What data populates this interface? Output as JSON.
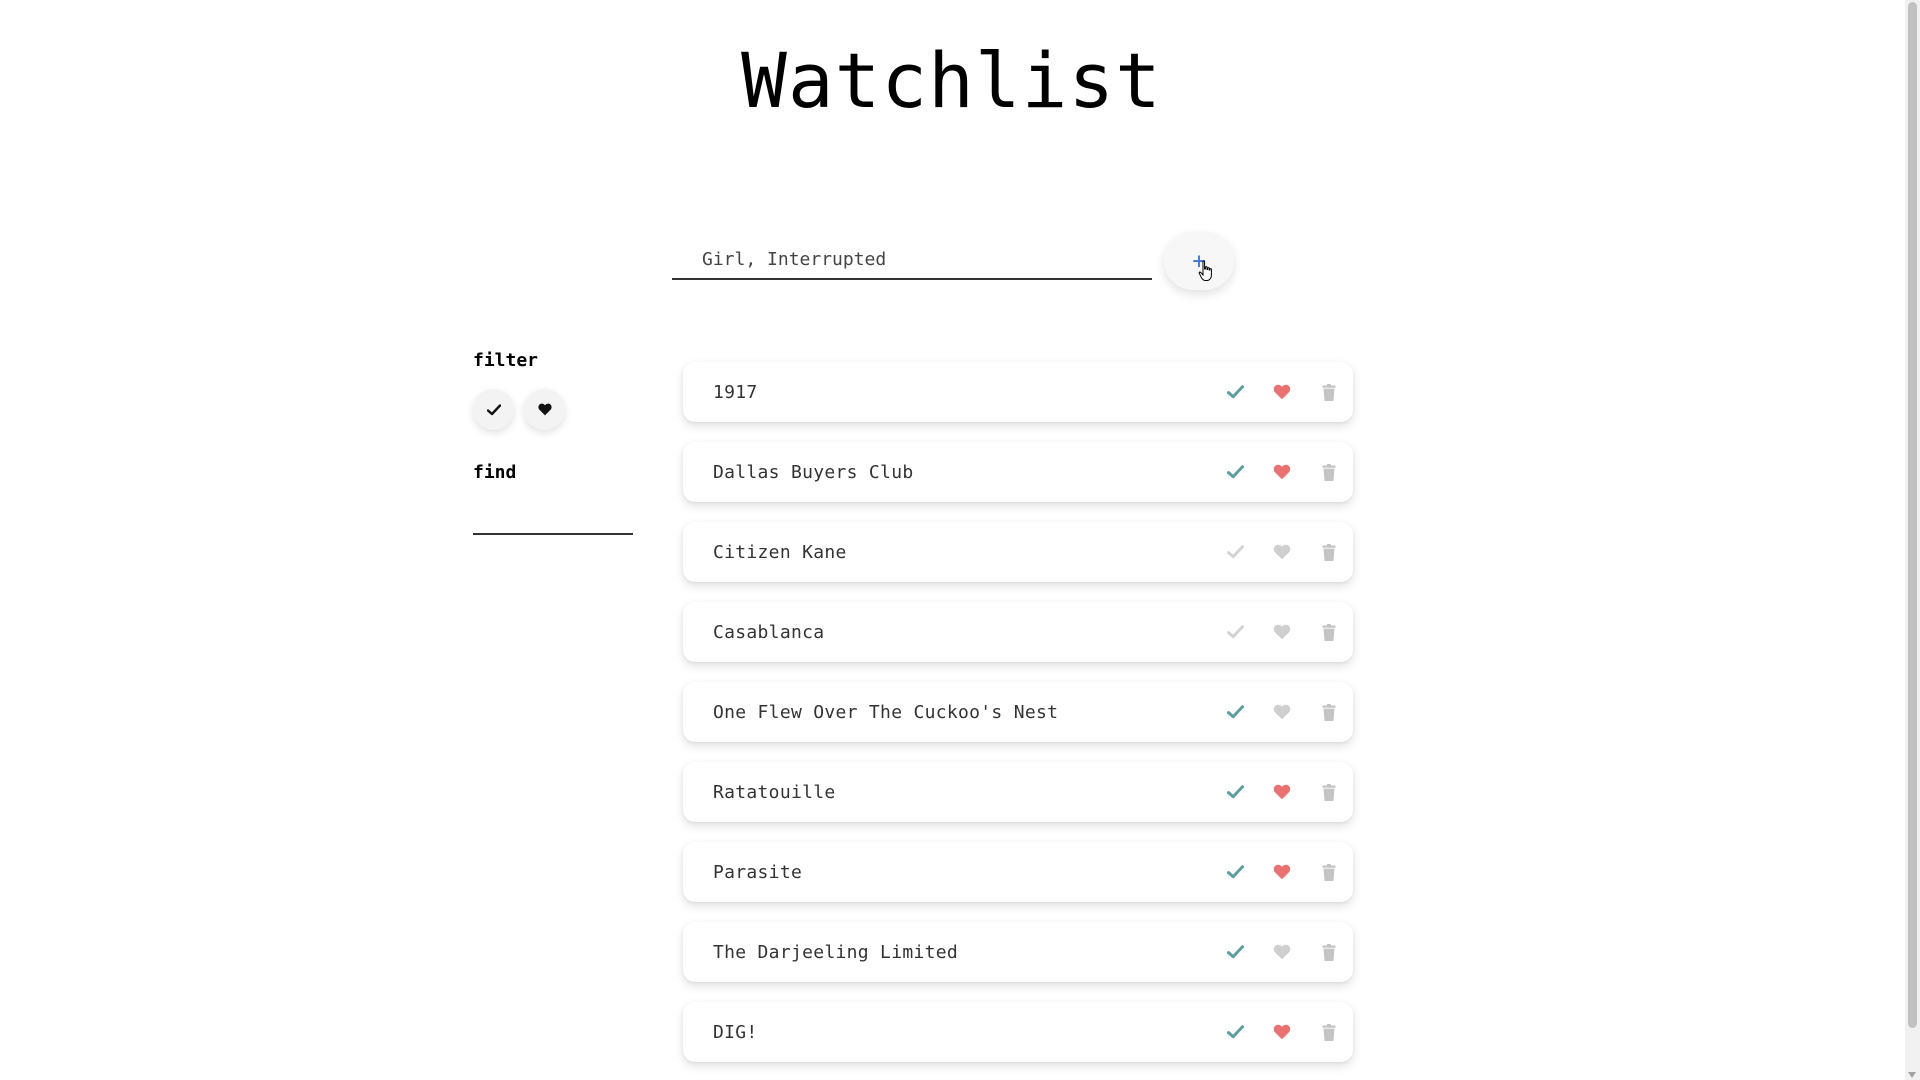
{
  "header": {
    "title": "Watchlist"
  },
  "add_form": {
    "input_value": "Girl, Interrupted",
    "button_label": "+"
  },
  "sidebar": {
    "filter_heading": "filter",
    "find_heading": "find",
    "find_value": "",
    "filters": [
      {
        "name": "check-icon"
      },
      {
        "name": "heart-icon"
      }
    ]
  },
  "colors": {
    "watched_active": "#5f9ea0",
    "watched_inactive": "#d3d3d3",
    "favorite_active": "#e97272",
    "favorite_inactive": "#cfcfcf",
    "delete": "#c4c4c4",
    "add_plus": "#3b73d6"
  },
  "movies": [
    {
      "title": "1917",
      "watched": true,
      "favorite": true
    },
    {
      "title": "Dallas Buyers Club",
      "watched": true,
      "favorite": true
    },
    {
      "title": "Citizen Kane",
      "watched": false,
      "favorite": false
    },
    {
      "title": "Casablanca",
      "watched": false,
      "favorite": false
    },
    {
      "title": "One Flew Over The Cuckoo's Nest",
      "watched": true,
      "favorite": false
    },
    {
      "title": "Ratatouille",
      "watched": true,
      "favorite": true
    },
    {
      "title": "Parasite",
      "watched": true,
      "favorite": true
    },
    {
      "title": "The Darjeeling Limited",
      "watched": true,
      "favorite": false
    },
    {
      "title": "DIG!",
      "watched": true,
      "favorite": true
    }
  ]
}
